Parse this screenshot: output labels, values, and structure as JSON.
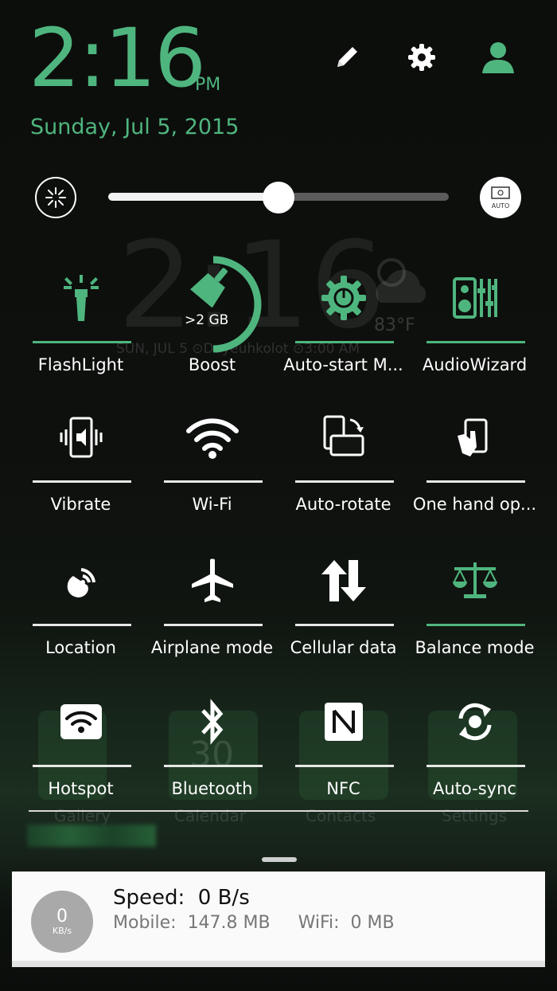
{
  "header": {
    "time": "2:16",
    "ampm": "PM",
    "date": "Sunday, Jul 5, 2015",
    "edit_icon": "pencil-icon",
    "settings_icon": "gear-icon",
    "user_icon": "person-icon"
  },
  "brightness": {
    "level": 0.5,
    "auto_label": "AUTO"
  },
  "wallpaper": {
    "clock": "2:16",
    "temp": "83°F",
    "line": "SUN, JUL 5  ⊙Dayeuhkolot  ⊙3:00 AM",
    "apps": [
      "Gallery",
      "Calendar",
      "Contacts",
      "Settings"
    ],
    "calendar_day": "30"
  },
  "boost": {
    "badge": ">2 GB"
  },
  "tiles": [
    {
      "label": "FlashLight",
      "icon": "flashlight-icon",
      "active": true
    },
    {
      "label": "Boost",
      "icon": "broom-icon",
      "active": false
    },
    {
      "label": "Auto-start M...",
      "icon": "gear-power-icon",
      "active": true
    },
    {
      "label": "AudioWizard",
      "icon": "equalizer-icon",
      "active": true
    },
    {
      "label": "Vibrate",
      "icon": "vibrate-icon",
      "active": false
    },
    {
      "label": "Wi-Fi",
      "icon": "wifi-icon",
      "active": false
    },
    {
      "label": "Auto-rotate",
      "icon": "rotate-icon",
      "active": false
    },
    {
      "label": "One hand op...",
      "icon": "one-hand-icon",
      "active": false
    },
    {
      "label": "Location",
      "icon": "location-icon",
      "active": false
    },
    {
      "label": "Airplane mode",
      "icon": "airplane-icon",
      "active": false
    },
    {
      "label": "Cellular data",
      "icon": "data-arrows-icon",
      "active": false
    },
    {
      "label": "Balance mode",
      "icon": "scale-icon",
      "active": true
    },
    {
      "label": "Hotspot",
      "icon": "hotspot-icon",
      "active": false
    },
    {
      "label": "Bluetooth",
      "icon": "bluetooth-icon",
      "active": false
    },
    {
      "label": "NFC",
      "icon": "nfc-icon",
      "active": false
    },
    {
      "label": "Auto-sync",
      "icon": "sync-icon",
      "active": false
    }
  ],
  "notification": {
    "speed_value": "0",
    "speed_unit": "KB/s",
    "speed_text": "Speed:  0 B/s",
    "usage_text": "Mobile:  147.8 MB     WiFi:  0 MB"
  },
  "colors": {
    "accent": "#4fb57e",
    "white": "#ffffff"
  }
}
